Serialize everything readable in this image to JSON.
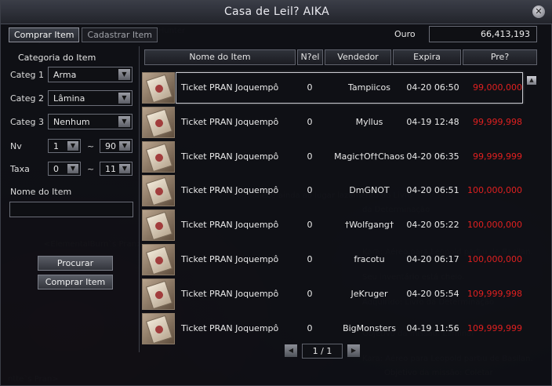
{
  "window": {
    "title": "Casa de Leil? AIKA"
  },
  "tabs": [
    {
      "label": "Comprar Item",
      "active": true
    },
    {
      "label": "Cadastrar Item",
      "active": false
    }
  ],
  "filters": {
    "category_heading": "Categoria do Item",
    "categ1": {
      "label": "Categ 1",
      "value": "Arma"
    },
    "categ2": {
      "label": "Categ 2",
      "value": "Lâmina"
    },
    "categ3": {
      "label": "Categ 3",
      "value": "Nenhum"
    },
    "level": {
      "label": "Nv",
      "min": "1",
      "max": "90",
      "sep": "~"
    },
    "tax": {
      "label": "Taxa",
      "min": "0",
      "max": "11",
      "sep": "~"
    },
    "item_name": {
      "label": "Nome do Item",
      "value": ""
    }
  },
  "buttons": {
    "search": "Procurar",
    "buy": "Comprar Item"
  },
  "gold": {
    "label": "Ouro",
    "value": "66,413,193"
  },
  "table": {
    "columns": [
      "Nome do Item",
      "N?el",
      "Vendedor",
      "Expira",
      "Pre?"
    ],
    "rows": [
      {
        "name": "Ticket PRAN Joquempô",
        "level": "0",
        "seller": "Tampiicos",
        "expires": "04-20 06:50",
        "price": "99,000,000",
        "price_color": "#e02020"
      },
      {
        "name": "Ticket PRAN Joquempô",
        "level": "0",
        "seller": "Myllus",
        "expires": "04-19 12:48",
        "price": "99,999,998",
        "price_color": "#e02020"
      },
      {
        "name": "Ticket PRAN Joquempô",
        "level": "0",
        "seller": "Magic†Of†Chaos",
        "expires": "04-20 06:35",
        "price": "99,999,999",
        "price_color": "#e02020"
      },
      {
        "name": "Ticket PRAN Joquempô",
        "level": "0",
        "seller": "DmGNOT",
        "expires": "04-20 06:51",
        "price": "100,000,000",
        "price_color": "#e02020"
      },
      {
        "name": "Ticket PRAN Joquempô",
        "level": "0",
        "seller": "†Wolfgang†",
        "expires": "04-20 05:22",
        "price": "100,000,000",
        "price_color": "#e02020"
      },
      {
        "name": "Ticket PRAN Joquempô",
        "level": "0",
        "seller": "fracotu",
        "expires": "04-20 06:17",
        "price": "100,000,000",
        "price_color": "#e02020"
      },
      {
        "name": "Ticket PRAN Joquempô",
        "level": "0",
        "seller": "JeKruger",
        "expires": "04-20 05:54",
        "price": "109,999,998",
        "price_color": "#e02020"
      },
      {
        "name": "Ticket PRAN Joquempô",
        "level": "0",
        "seller": "BigMonsters",
        "expires": "04-19 11:56",
        "price": "109,999,999",
        "price_color": "#e02020"
      }
    ]
  },
  "pager": {
    "text": "1 / 1"
  },
  "icons": {
    "close": "close-icon",
    "dropdown": "chevron-down-icon",
    "prev": "triangle-left-icon",
    "next": "triangle-right-icon",
    "scroll_up": "triangle-up-icon",
    "item": "ticket-icon"
  },
  "colors": {
    "price": "#e02020",
    "accent": "#c9cad0"
  }
}
